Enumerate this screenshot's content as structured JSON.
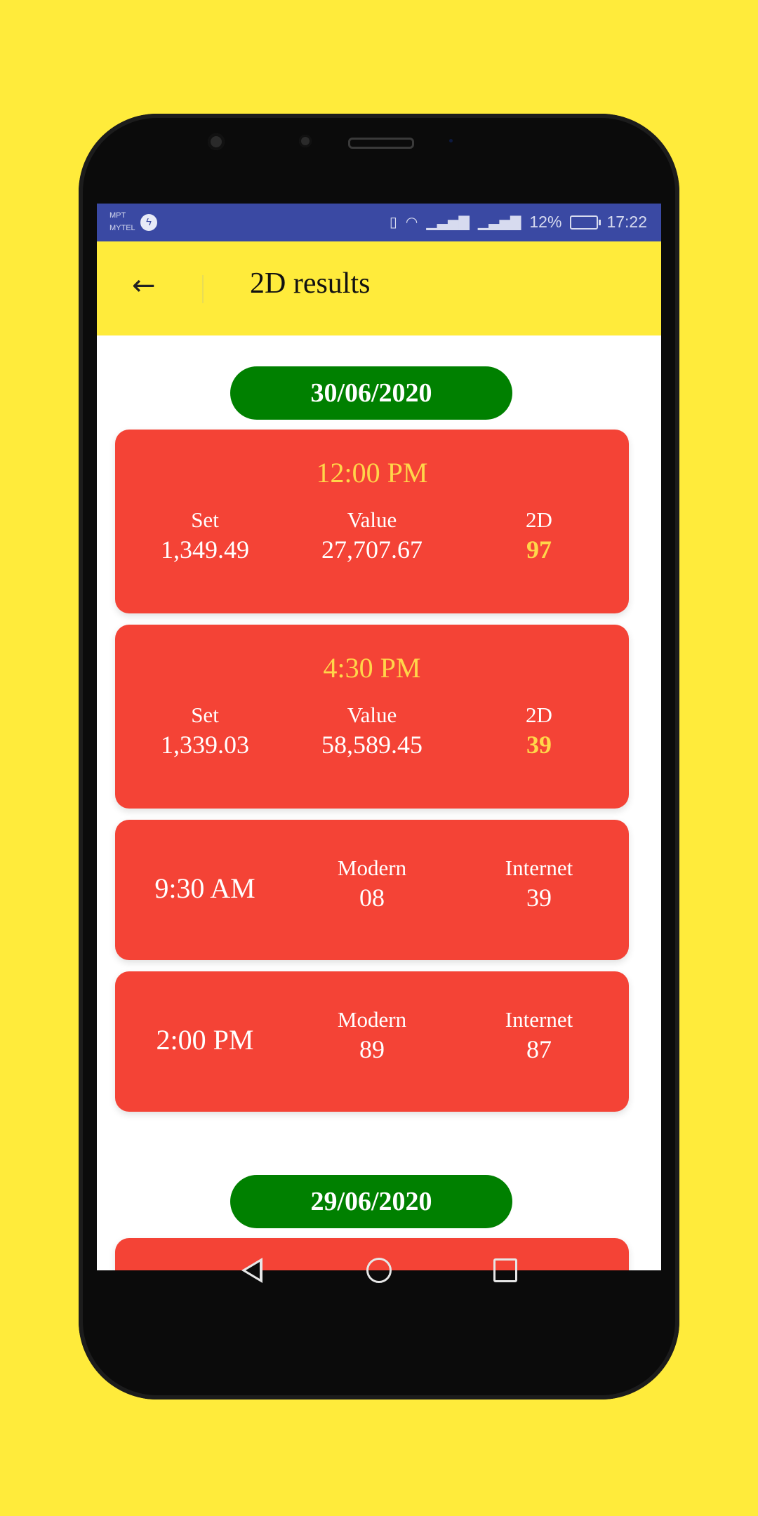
{
  "status_bar": {
    "carrier_1": "MPT",
    "carrier_2": "MYTEL",
    "battery": "12%",
    "time": "17:22"
  },
  "app_bar": {
    "title": "2D results"
  },
  "days": [
    {
      "date": "30/06/2020",
      "results": [
        {
          "time": "12:00 PM",
          "set_label": "Set",
          "set": "1,349.49",
          "value_label": "Value",
          "value": "27,707.67",
          "twod_label": "2D",
          "twod": "97"
        },
        {
          "time": "4:30 PM",
          "set_label": "Set",
          "set": "1,339.03",
          "value_label": "Value",
          "value": "58,589.45",
          "twod_label": "2D",
          "twod": "39"
        }
      ],
      "slots": [
        {
          "time": "9:30 AM",
          "modern_label": "Modern",
          "modern": "08",
          "internet_label": "Internet",
          "internet": "39"
        },
        {
          "time": "2:00 PM",
          "modern_label": "Modern",
          "modern": "89",
          "internet_label": "Internet",
          "internet": "87"
        }
      ]
    },
    {
      "date": "29/06/2020"
    }
  ],
  "colors": {
    "background": "#ffeb3b",
    "status_bar": "#3a49a3",
    "app_bar": "#ffeb3b",
    "date_pill": "#008000",
    "card": "#f44336",
    "highlight": "#ffd64a"
  }
}
